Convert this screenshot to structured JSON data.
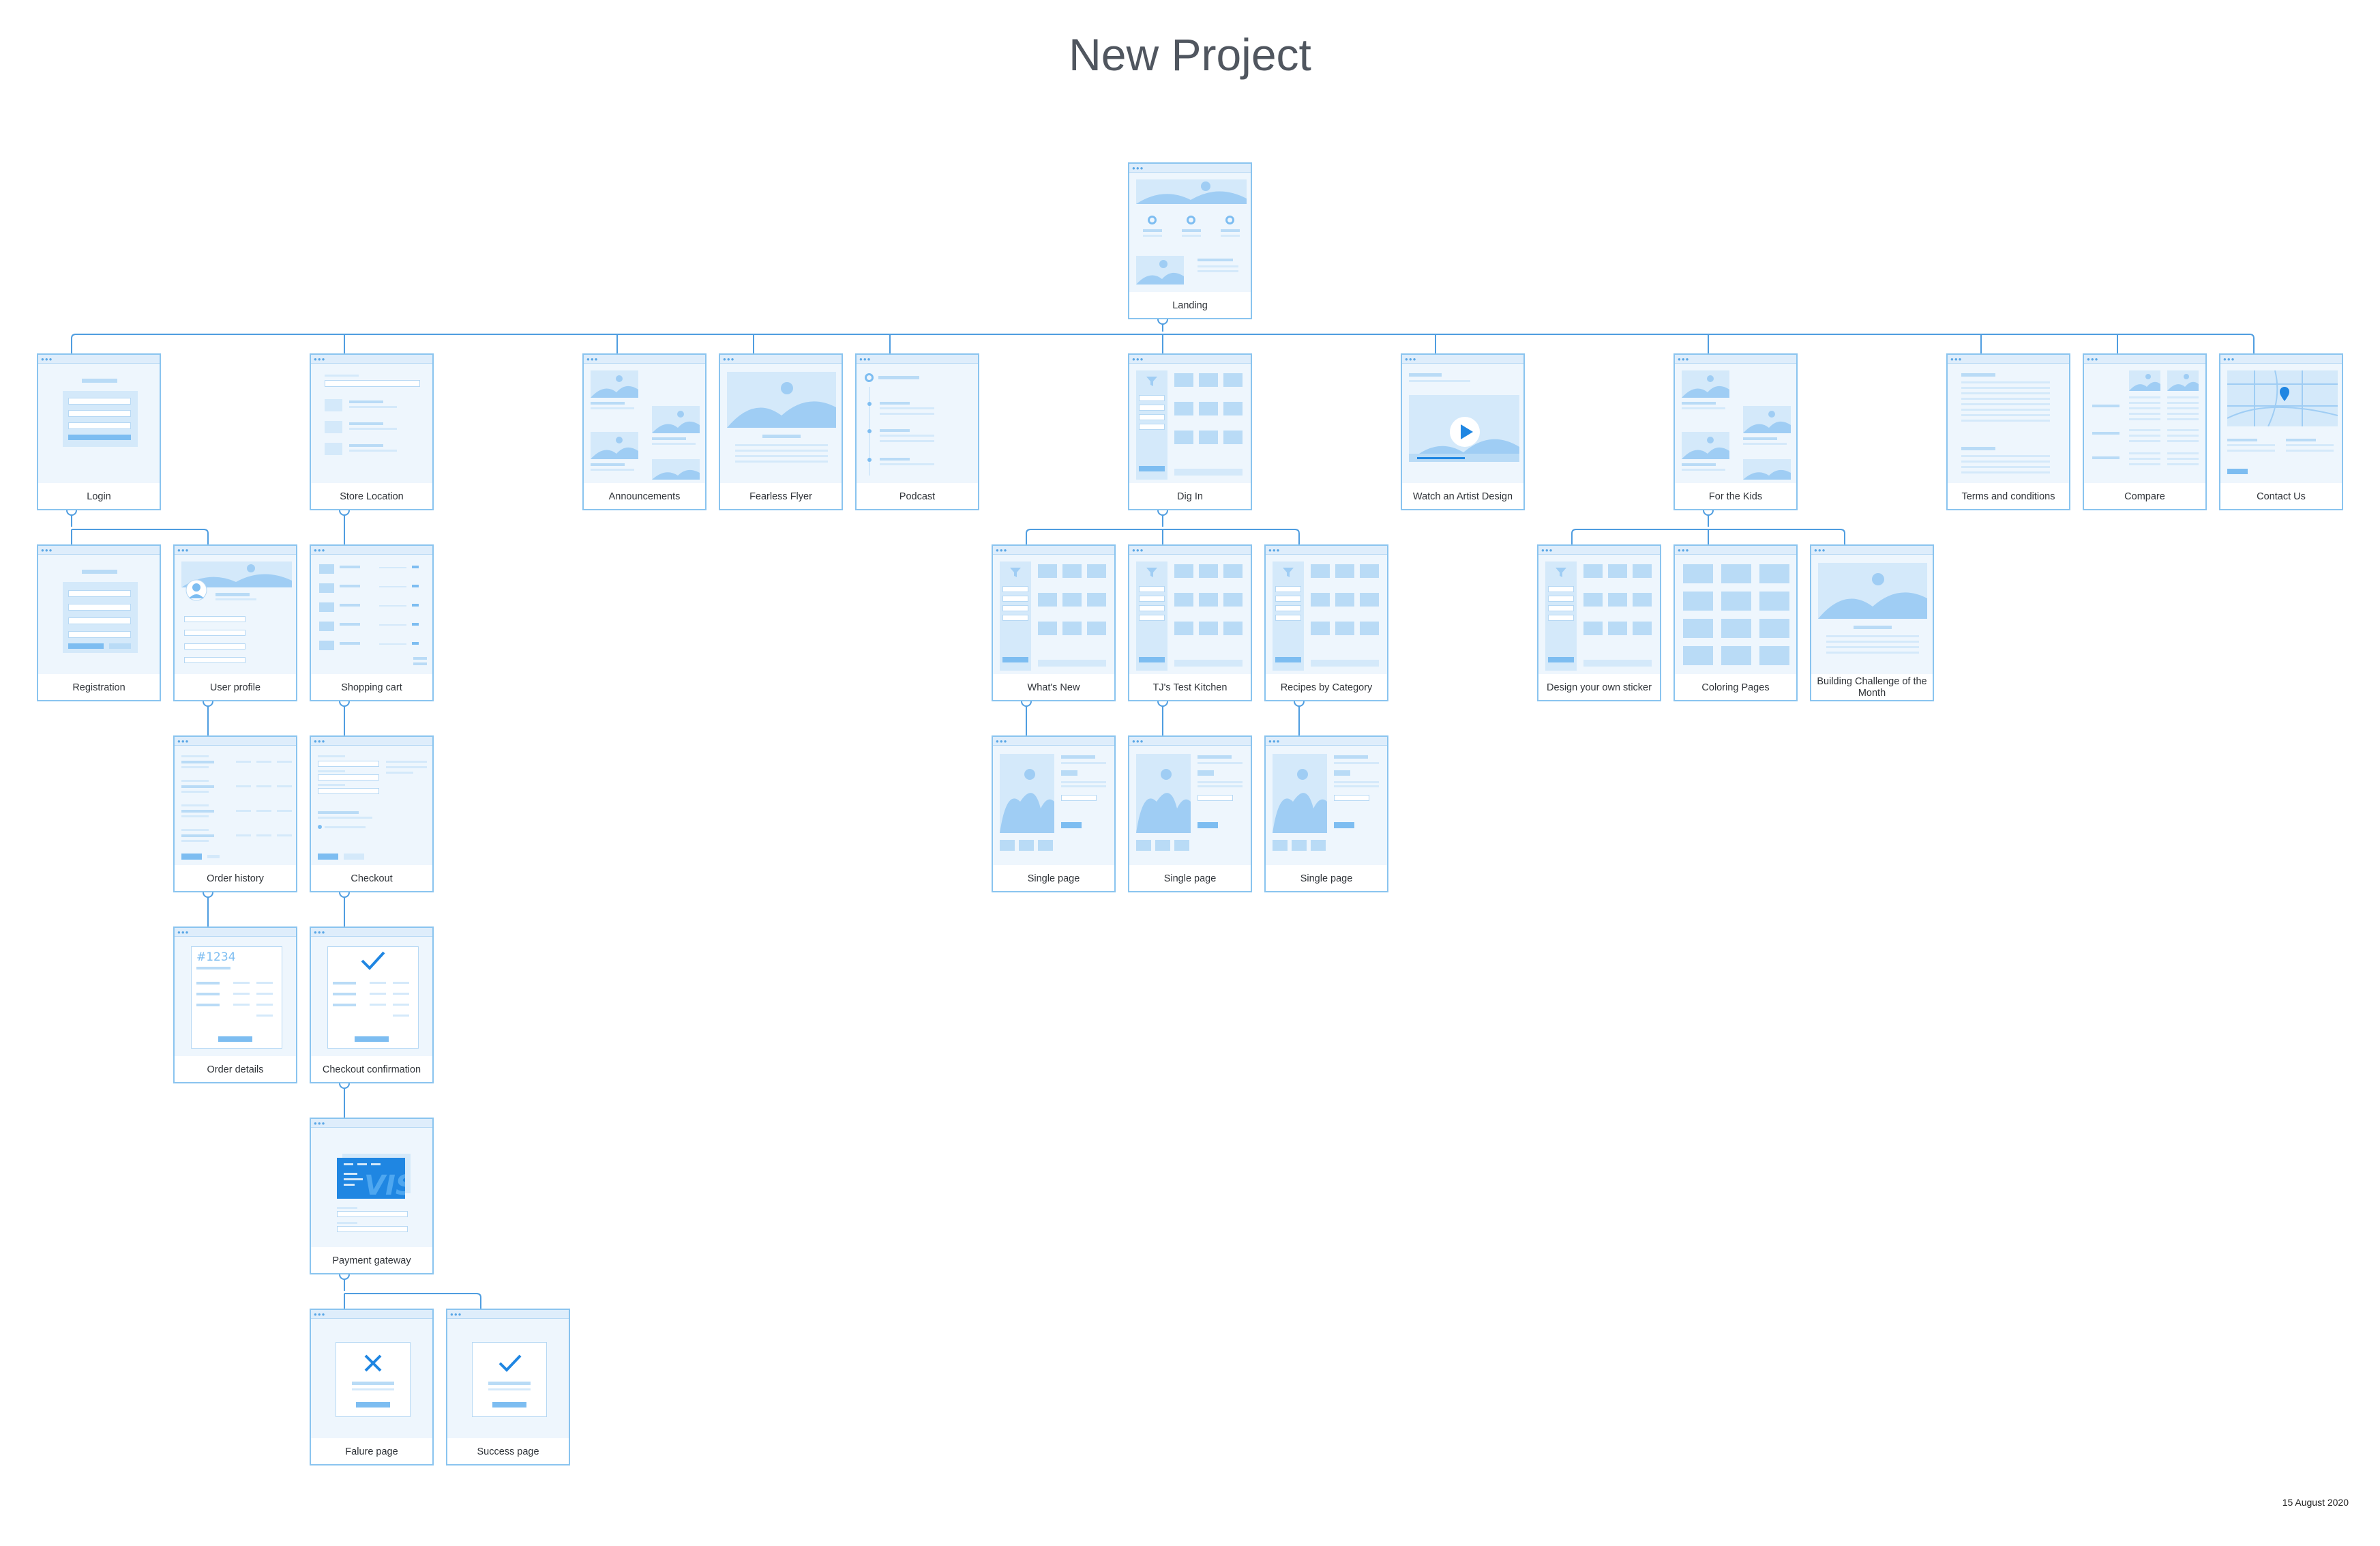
{
  "title": "New Project",
  "date": "15 August 2020",
  "nodes": {
    "landing": "Landing",
    "login": "Login",
    "store_location": "Store Location",
    "announcements": "Announcements",
    "fearless_flyer": "Fearless Flyer",
    "podcast": "Podcast",
    "dig_in": "Dig In",
    "watch_artist": "Watch an Artist Design",
    "for_kids": "For the Kids",
    "terms": "Terms and conditions",
    "compare": "Compare",
    "contact": "Contact Us",
    "registration": "Registration",
    "user_profile": "User profile",
    "shopping_cart": "Shopping cart",
    "whats_new": "What's New",
    "tjs_kitchen": "TJ's Test Kitchen",
    "recipes_category": "Recipes by Category",
    "design_sticker": "Design your own sticker",
    "coloring_pages": "Coloring Pages",
    "building_challenge": "Building Challenge of the Month",
    "order_history": "Order history",
    "checkout": "Checkout",
    "single_page_1": "Single page",
    "single_page_2": "Single page",
    "single_page_3": "Single page",
    "order_details": "Order details",
    "checkout_confirmation": "Checkout confirmation",
    "payment_gateway": "Payment gateway",
    "failure_page": "Falure page",
    "success_page": "Success page"
  },
  "preview_text": {
    "order_number": "#1234",
    "card_brand": "VISA",
    "window_dots": "●●●"
  },
  "icons": {
    "play": "play-icon",
    "check": "check-icon",
    "cross": "cross-icon",
    "map_pin": "map-pin-icon",
    "filter": "filter-icon"
  },
  "colors": {
    "title": "#50565f",
    "node_border": "#8ac4ef",
    "preview_fill": "#eef6fd",
    "accent": "#1f86e2",
    "connector": "#4f9de0"
  }
}
